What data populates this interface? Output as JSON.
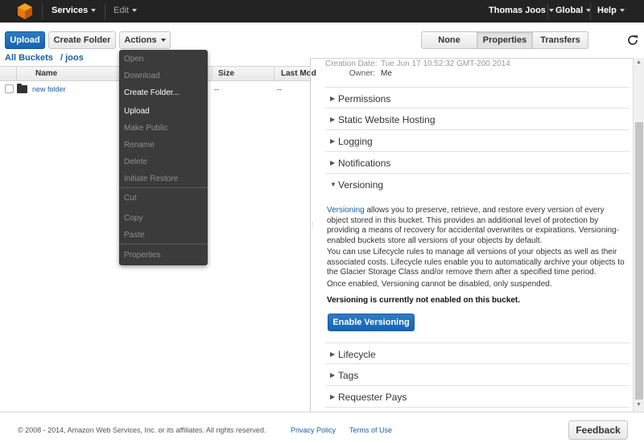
{
  "nav": {
    "services": "Services",
    "edit": "Edit",
    "user": "Thomas Joos",
    "region": "Global",
    "help": "Help"
  },
  "toolbar": {
    "upload": "Upload",
    "create_folder": "Create Folder",
    "actions": "Actions",
    "view_tabs": [
      "None",
      "Properties",
      "Transfers"
    ],
    "active_tab": "Properties"
  },
  "breadcrumb": {
    "root": "All Buckets",
    "current": "/ joos"
  },
  "table": {
    "headers": [
      "Name",
      "Size",
      "Last Mod"
    ],
    "rows": [
      {
        "name": "new folder",
        "size": "--",
        "last_modified": "--"
      }
    ]
  },
  "actions_menu": {
    "items": [
      {
        "label": "Open",
        "enabled": false
      },
      {
        "label": "Download",
        "enabled": false
      },
      {
        "label": "Create Folder...",
        "enabled": true
      },
      {
        "label": "Upload",
        "enabled": true
      },
      {
        "label": "Make Public",
        "enabled": false
      },
      {
        "label": "Rename",
        "enabled": false
      },
      {
        "label": "Delete",
        "enabled": false
      },
      {
        "label": "Initiate Restore",
        "enabled": false
      },
      {
        "label": "Cut",
        "enabled": false
      },
      {
        "label": "Copy",
        "enabled": false
      },
      {
        "label": "Paste",
        "enabled": false
      },
      {
        "label": "Properties",
        "enabled": false
      }
    ]
  },
  "properties": {
    "creation_date_label": "Creation Date:",
    "creation_date_value": "Tue Jun 17 10:52:32 GMT-200 2014",
    "owner_label": "Owner:",
    "owner_value": "Me",
    "sections_before": [
      "Permissions",
      "Static Website Hosting",
      "Logging",
      "Notifications"
    ],
    "versioning": {
      "title": "Versioning",
      "link_word": "Versioning",
      "para1_rest": " allows you to preserve, retrieve, and restore every version of every object stored in this bucket. This provides an additional level of protection by providing a means of recovery for accidental overwrites or expirations. Versioning-enabled buckets store all versions of your objects by default.",
      "para2": "You can use Lifecycle rules to manage all versions of your objects as well as their associated costs. Lifecycle rules enable you to automatically archive your objects to the Glacier Storage Class and/or remove them after a specified time period.",
      "para3": "Once enabled, Versioning cannot be disabled, only suspended.",
      "status": "Versioning is currently not enabled on this bucket.",
      "button": "Enable Versioning"
    },
    "sections_after": [
      "Lifecycle",
      "Tags",
      "Requester Pays"
    ]
  },
  "footer": {
    "copyright": "© 2008 - 2014, Amazon Web Services, Inc. or its affiliates. All rights reserved.",
    "privacy": "Privacy Policy",
    "terms": "Terms of Use",
    "feedback": "Feedback"
  }
}
